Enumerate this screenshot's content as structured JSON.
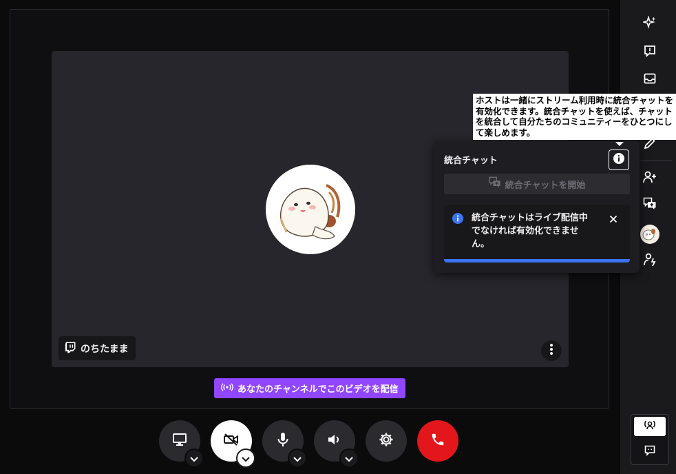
{
  "stream": {
    "streamer_name": "のちたまま",
    "broadcast_label": "あなたのチャンネルでこのビデオを配信"
  },
  "chat_panel": {
    "title": "統合チャット",
    "start_label": "統合チャットを開始",
    "notice_text": "統合チャットはライブ配信中でなければ有効化できません。",
    "tooltip_text": "ホストは一緒にストリーム利用時に統合チャットを有効化できます。統合チャットを使えば、チャットを統合して自分たちのコミュニティーをひとつにして楽しめます。"
  },
  "controls": [
    "screen-share-icon",
    "camera-off-icon",
    "microphone-icon",
    "speaker-icon",
    "settings-icon",
    "hang-up-icon"
  ],
  "rail_icons": [
    "sparkle-icon",
    "alert-icon",
    "inbox-icon",
    "pencil-icon",
    "add-user-icon",
    "chat-merge-icon",
    "guest-avatar",
    "guest-star-icon"
  ],
  "colors": {
    "twitch_purple": "#9146ff",
    "hangup_red": "#e3161b",
    "info_blue": "#3b73f0"
  }
}
